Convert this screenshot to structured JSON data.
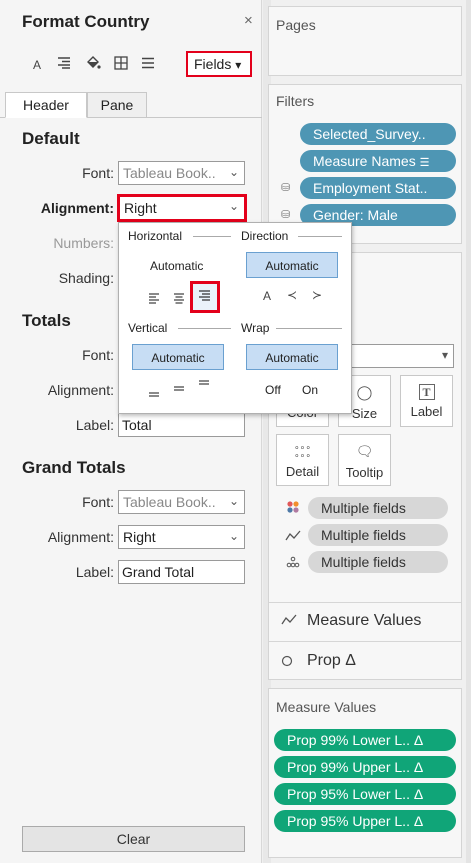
{
  "format_pane": {
    "title": "Format Country",
    "close": "×",
    "toolbar": {
      "fields_label": "Fields",
      "fields_arrow": "▾"
    },
    "tabs": [
      "Header",
      "Pane"
    ],
    "default": {
      "heading": "Default",
      "font_label": "Font:",
      "font_value": "Tableau Book..",
      "alignment_label": "Alignment:",
      "alignment_value": "Right",
      "numbers_label": "Numbers:",
      "shading_label": "Shading:"
    },
    "totals": {
      "heading": "Totals",
      "font_label": "Font:",
      "alignment_label": "Alignment:",
      "label_label": "Label:",
      "label_value": "Total"
    },
    "grand_totals": {
      "heading": "Grand Totals",
      "font_label": "Font:",
      "font_value": "Tableau Book..",
      "alignment_label": "Alignment:",
      "alignment_value": "Right",
      "label_label": "Label:",
      "label_value": "Grand Total"
    },
    "clear_label": "Clear"
  },
  "alignment_popup": {
    "horizontal_label": "Horizontal",
    "direction_label": "Direction",
    "horizontal_value": "Automatic",
    "direction_value": "Automatic",
    "vertical_label": "Vertical",
    "wrap_label": "Wrap",
    "vertical_value": "Automatic",
    "wrap_value": "Automatic",
    "direction_icons": [
      "A",
      "≺",
      "≻"
    ],
    "wrap_off": "Off",
    "wrap_on": "On"
  },
  "pages": {
    "title": "Pages"
  },
  "filters": {
    "title": "Filters",
    "items": [
      "Selected_Survey..",
      "Measure Names",
      "Employment Stat..",
      "Gender: Male"
    ]
  },
  "marks": {
    "type_value": "e",
    "buttons": [
      {
        "label": "Color",
        "icon": "color-icon"
      },
      {
        "label": "Size",
        "icon": "size-icon"
      },
      {
        "label": "Label",
        "icon": "label-icon",
        "glyph": "T"
      },
      {
        "label": "Detail",
        "icon": "detail-icon"
      },
      {
        "label": "Tooltip",
        "icon": "tooltip-icon"
      }
    ],
    "fields": [
      "Multiple fields",
      "Multiple fields",
      "Multiple fields"
    ],
    "rows": [
      "Measure Values",
      "Prop Δ"
    ]
  },
  "measure_values": {
    "title": "Measure Values",
    "items": [
      "Prop 99% Lower L..  Δ",
      "Prop 99% Upper L..  Δ",
      "Prop 95% Lower L..  Δ",
      "Prop 95% Upper L..  Δ"
    ]
  },
  "colors": {
    "highlight_red": "#e3001b",
    "filter_pill": "#4e96b4",
    "measure_pill": "#10a578",
    "selected_button": "#c7ddf4"
  }
}
